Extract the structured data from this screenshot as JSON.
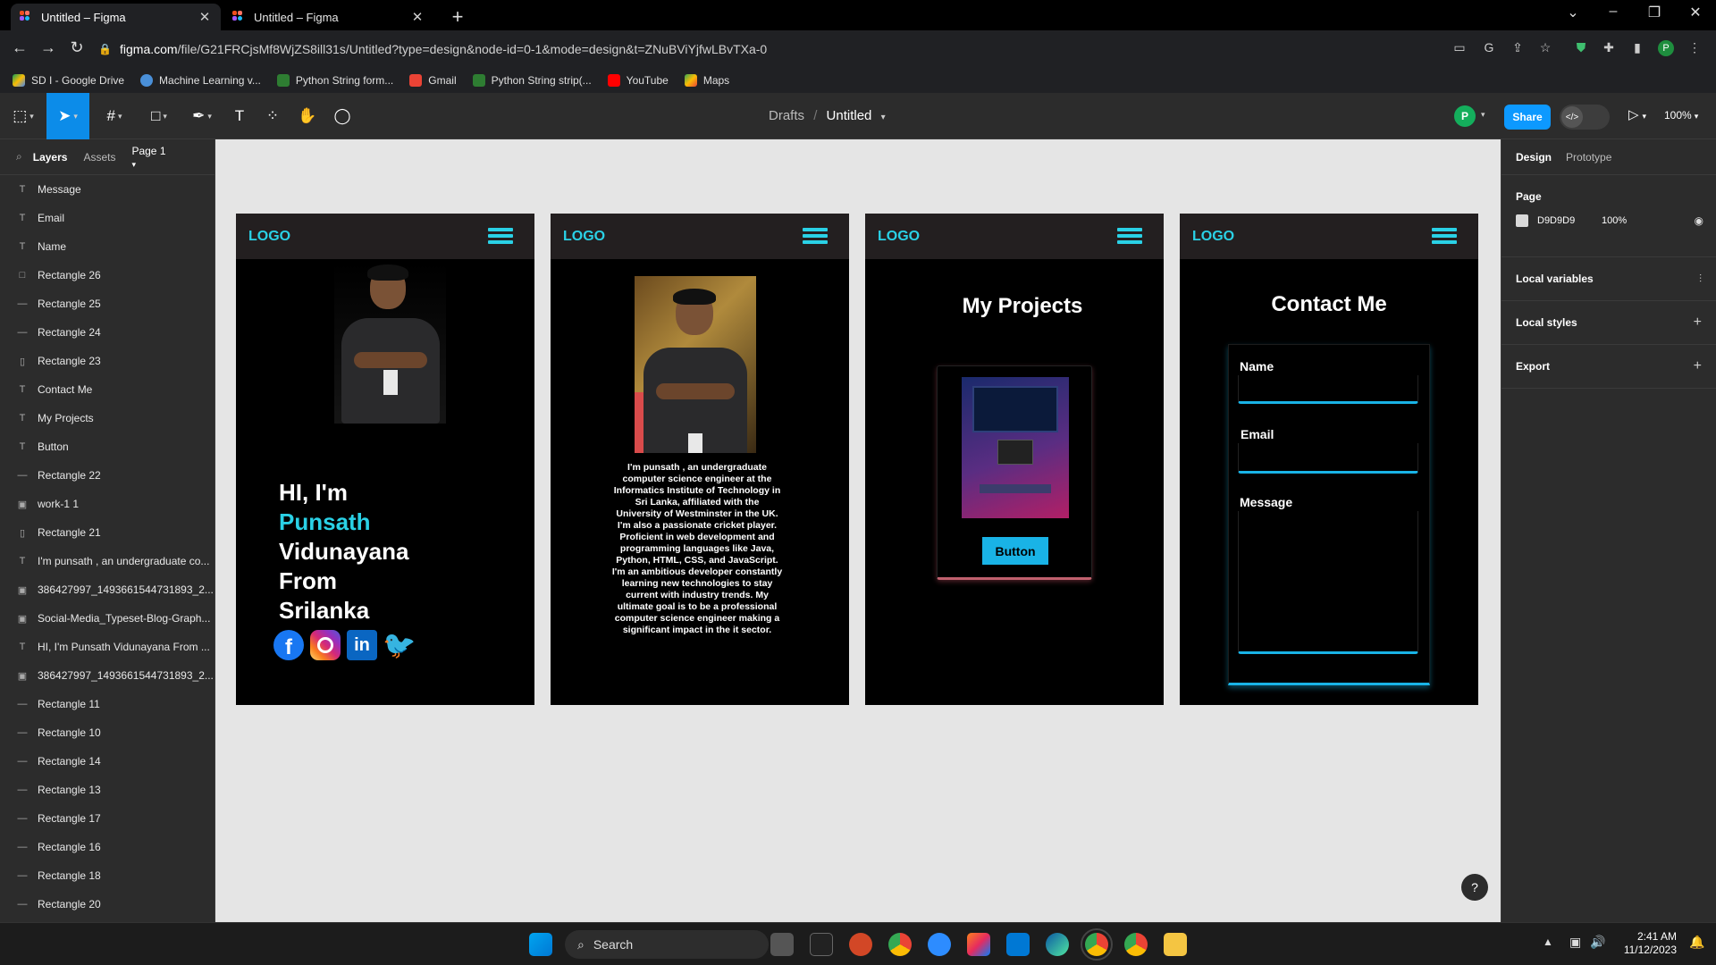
{
  "browser": {
    "tabs": [
      {
        "title": "Untitled – Figma",
        "active": true
      },
      {
        "title": "Untitled – Figma",
        "active": false
      }
    ],
    "url_domain": "figma.com",
    "url_path": "/file/G21FRCjsMf8WjZS8ill31s/Untitled?type=design&node-id=0-1&mode=design&t=ZNuBViYjfwLBvTXa-0",
    "bookmarks": [
      "SD I - Google Drive",
      "Machine Learning v...",
      "Python String form...",
      "Gmail",
      "Python String strip(...",
      "YouTube",
      "Maps"
    ]
  },
  "figma_toolbar": {
    "breadcrumb_parent": "Drafts",
    "separator": "/",
    "file_name": "Untitled",
    "avatar_initial": "P",
    "share_label": "Share",
    "zoom": "100%"
  },
  "left_panel": {
    "tabs": [
      "Layers",
      "Assets"
    ],
    "page": "Page 1",
    "layers": [
      {
        "icon": "T",
        "name": "Message"
      },
      {
        "icon": "T",
        "name": "Email"
      },
      {
        "icon": "T",
        "name": "Name"
      },
      {
        "icon": "□",
        "name": "Rectangle 26"
      },
      {
        "icon": "—",
        "name": "Rectangle 25"
      },
      {
        "icon": "—",
        "name": "Rectangle 24"
      },
      {
        "icon": "▯",
        "name": "Rectangle 23"
      },
      {
        "icon": "T",
        "name": "Contact Me"
      },
      {
        "icon": "T",
        "name": "My Projects"
      },
      {
        "icon": "T",
        "name": "Button"
      },
      {
        "icon": "—",
        "name": "Rectangle 22"
      },
      {
        "icon": "▣",
        "name": "work-1 1"
      },
      {
        "icon": "▯",
        "name": "Rectangle 21"
      },
      {
        "icon": "T",
        "name": "I'm punsath , an undergraduate co..."
      },
      {
        "icon": "▣",
        "name": "386427997_1493661544731893_2..."
      },
      {
        "icon": "▣",
        "name": "Social-Media_Typeset-Blog-Graph..."
      },
      {
        "icon": "T",
        "name": "HI, I'm Punsath Vidunayana From ..."
      },
      {
        "icon": "▣",
        "name": "386427997_1493661544731893_2..."
      },
      {
        "icon": "—",
        "name": "Rectangle 11"
      },
      {
        "icon": "—",
        "name": "Rectangle 10"
      },
      {
        "icon": "—",
        "name": "Rectangle 14"
      },
      {
        "icon": "—",
        "name": "Rectangle 13"
      },
      {
        "icon": "—",
        "name": "Rectangle 17"
      },
      {
        "icon": "—",
        "name": "Rectangle 16"
      },
      {
        "icon": "—",
        "name": "Rectangle 18"
      },
      {
        "icon": "—",
        "name": "Rectangle 20"
      }
    ]
  },
  "right_panel": {
    "tabs": [
      "Design",
      "Prototype"
    ],
    "page_label": "Page",
    "page_color": "D9D9D9",
    "page_opacity": "100%",
    "sections": [
      "Local variables",
      "Local styles",
      "Export"
    ]
  },
  "frames": {
    "logo": "LOGO",
    "hero": {
      "line1": "HI, I'm",
      "name1": "Punsath",
      "name2": "Vidunayana",
      "line4": "From",
      "line5": "Srilanka"
    },
    "about_text": "I'm punsath , an undergraduate computer science engineer at the Informatics Institute of Technology in Sri Lanka, affiliated with the University of Westminster in the UK. I'm also a passionate cricket player. Proficient in web development and programming languages like Java, Python, HTML, CSS, and JavaScript. I'm an ambitious developer constantly learning new technologies to stay current with industry trends. My ultimate goal is to be a professional computer science engineer making a significant impact in the it sector.",
    "projects_title": "My Projects",
    "button_label": "Button",
    "contact_title": "Contact Me",
    "fields": [
      "Name",
      "Email",
      "Message"
    ]
  },
  "taskbar": {
    "search_label": "Search",
    "time": "2:41 AM",
    "date": "11/12/2023"
  },
  "colors": {
    "accent": "#2ad1e6",
    "figma_blue": "#0d99ff",
    "canvas_bg": "#e5e5e5"
  }
}
